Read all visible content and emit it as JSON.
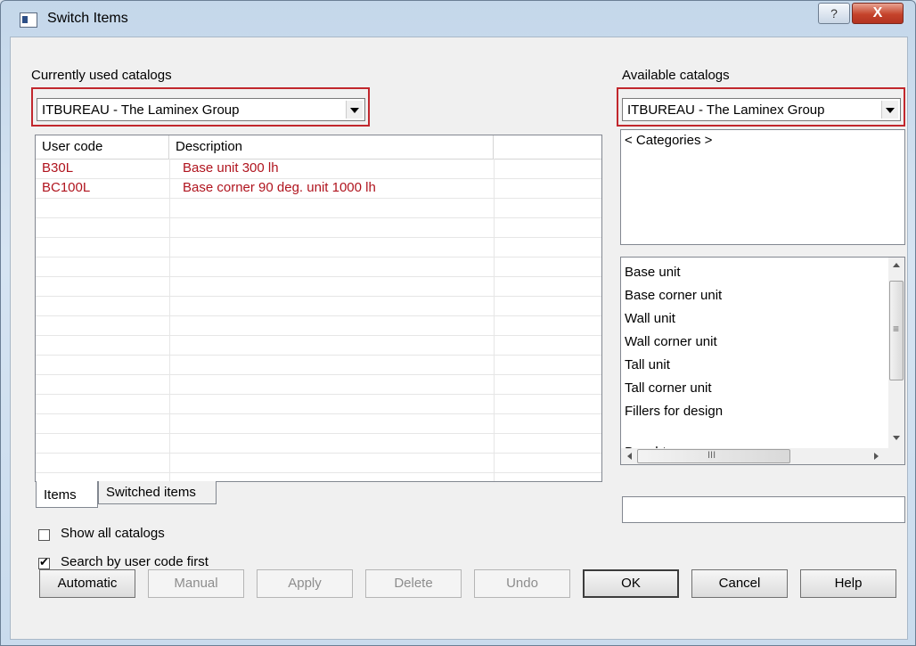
{
  "window": {
    "title": "Switch Items",
    "help_glyph": "?",
    "close_glyph": "X"
  },
  "left": {
    "label": "Currently used catalogs",
    "catalog_selected": "ITBUREAU - The Laminex Group",
    "columns": [
      "User code",
      "Description"
    ],
    "rows": [
      {
        "code": "B30L",
        "description": "Base unit 300 lh"
      },
      {
        "code": "BC100L",
        "description": "Base corner 90 deg. unit 1000 lh"
      }
    ],
    "tabs": [
      "Items",
      "Switched items"
    ],
    "show_all_catalogs": {
      "label": "Show all catalogs",
      "checked": false
    },
    "search_by_user_code": {
      "label": "Search by user code first",
      "checked": true
    }
  },
  "right": {
    "label": "Available catalogs",
    "catalog_selected": "ITBUREAU - The Laminex Group",
    "categories_header": "< Categories >",
    "items": [
      "Base unit",
      "Base corner unit",
      "Wall unit",
      "Wall corner unit",
      "Tall unit",
      "Tall corner unit",
      "Fillers for design",
      "",
      "Benchtop"
    ],
    "search_value": "",
    "hscroll_glyph": "III",
    "vscroll_glyph": "≡"
  },
  "buttons": {
    "automatic": "Automatic",
    "manual": "Manual",
    "apply": "Apply",
    "delete": "Delete",
    "undo": "Undo",
    "ok": "OK",
    "cancel": "Cancel",
    "help": "Help"
  },
  "colors": {
    "highlight_border": "#c1272d",
    "item_text": "#b0141e"
  }
}
